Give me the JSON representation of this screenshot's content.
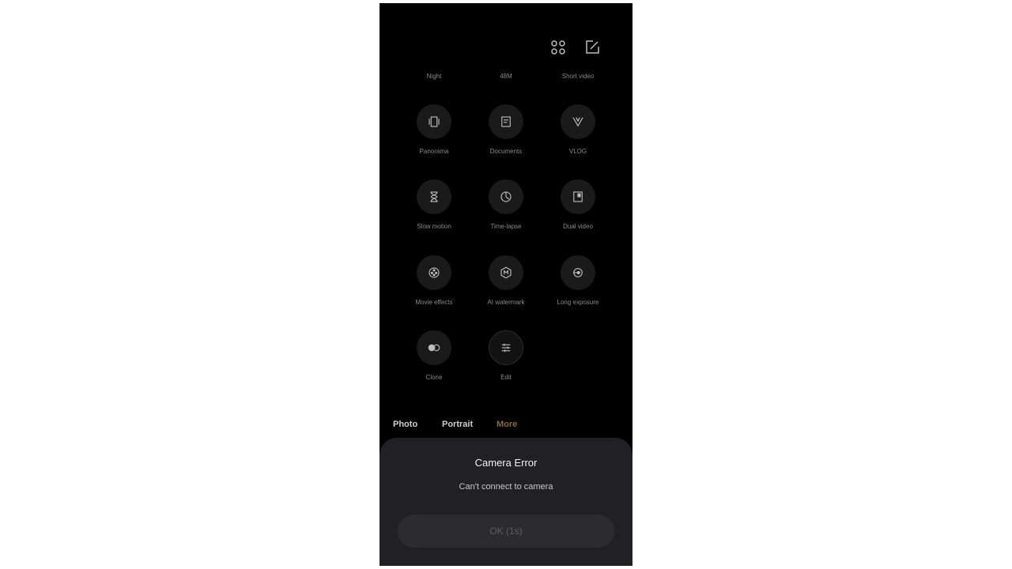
{
  "header": {
    "grid_icon": "grid-four-dots-icon",
    "edit_icon": "edit-square-icon"
  },
  "top_labels": [
    "Night",
    "48M",
    "Short video"
  ],
  "modes": [
    {
      "label": "Panorama",
      "icon": "panorama-icon"
    },
    {
      "label": "Documents",
      "icon": "documents-icon"
    },
    {
      "label": "VLOG",
      "icon": "vlog-icon"
    },
    {
      "label": "Slow motion",
      "icon": "hourglass-icon"
    },
    {
      "label": "Time-lapse",
      "icon": "time-lapse-icon"
    },
    {
      "label": "Dual video",
      "icon": "dual-video-icon"
    },
    {
      "label": "Movie effects",
      "icon": "movie-reel-icon"
    },
    {
      "label": "AI watermark",
      "icon": "ai-watermark-icon"
    },
    {
      "label": "Long exposure",
      "icon": "long-exposure-icon"
    },
    {
      "label": "Clone",
      "icon": "clone-icon"
    },
    {
      "label": "Edit",
      "icon": "sliders-icon"
    }
  ],
  "tabs": [
    {
      "label": "Photo",
      "active": false
    },
    {
      "label": "Portrait",
      "active": false
    },
    {
      "label": "More",
      "active": true
    }
  ],
  "dialog": {
    "title": "Camera Error",
    "message": "Can't connect to camera",
    "ok_label": "OK (1s)"
  },
  "colors": {
    "background": "#000000",
    "active_tab": "#8a6a3e",
    "sheet": "#212123"
  }
}
